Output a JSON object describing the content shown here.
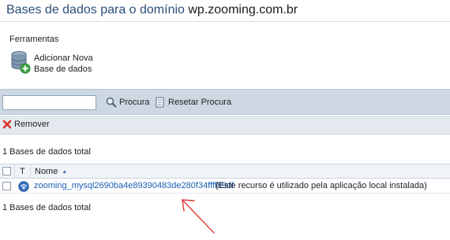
{
  "header": {
    "title_main": "Bases de dados para o domínio ",
    "title_domain": "wp.zooming.com.br"
  },
  "tools": {
    "section_label": "Ferramentas",
    "add_db_line1": "Adicionar Nova",
    "add_db_line2": "Base de dados"
  },
  "search": {
    "value": "",
    "search_label": "Procura",
    "reset_label": "Resetar Procura"
  },
  "actions": {
    "remove_label": "Remover"
  },
  "list": {
    "total_top": "1 Bases de dados total",
    "total_bottom": "1 Bases de dados total",
    "columns": {
      "type": "T",
      "name": "Nome"
    },
    "rows": [
      {
        "name": "zooming_mysql2690ba4e89390483de280f34ffff89df",
        "note": "(Este recurso é utilizado pela aplicação local instalada)"
      }
    ]
  },
  "colors": {
    "title_blue": "#2a4f7a",
    "link_blue": "#1a5fb4",
    "toolbar_bg": "#cdd8e3",
    "annotation_red": "#e03a3a"
  }
}
